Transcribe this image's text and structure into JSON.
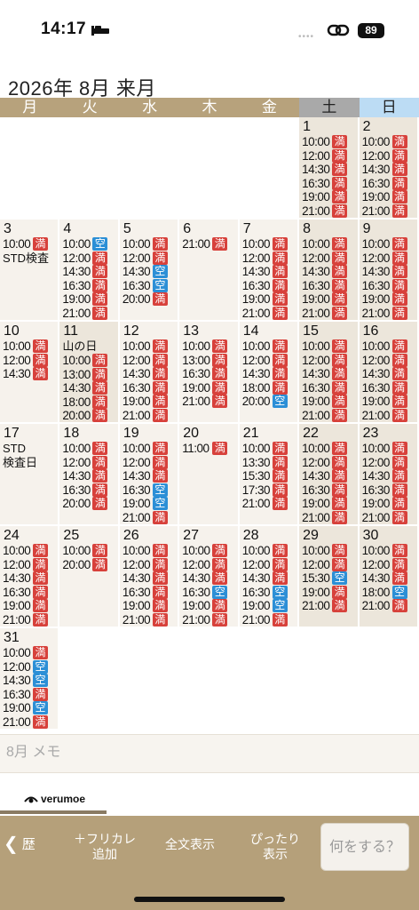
{
  "status_bar": {
    "time": "14:17",
    "battery": "89"
  },
  "calendar": {
    "title": "2026年 8月 来月",
    "weekdays": [
      "月",
      "火",
      "水",
      "木",
      "金",
      "土",
      "日"
    ],
    "labels": {
      "full": "満",
      "open": "空"
    }
  },
  "memo": {
    "placeholder": "8月 メモ"
  },
  "brand": {
    "name": "verumoe"
  },
  "toolbar": {
    "history": "歴",
    "add_free_line1": "＋フリカレ",
    "add_free_line2": "追加",
    "full_text": "全文表示",
    "fit_line1": "ぴったり",
    "fit_line2": "表示",
    "action": "何をする？"
  },
  "days": [
    {
      "d": "1",
      "wk": true,
      "s": [
        [
          "10:00",
          "f"
        ],
        [
          "12:00",
          "f"
        ],
        [
          "14:30",
          "f"
        ],
        [
          "16:30",
          "f"
        ],
        [
          "19:00",
          "f"
        ],
        [
          "21:00",
          "f"
        ]
      ]
    },
    {
      "d": "2",
      "wk": true,
      "s": [
        [
          "10:00",
          "f"
        ],
        [
          "12:00",
          "f"
        ],
        [
          "14:30",
          "f"
        ],
        [
          "16:30",
          "f"
        ],
        [
          "19:00",
          "f"
        ],
        [
          "21:00",
          "f"
        ]
      ]
    },
    {
      "d": "3",
      "s": [
        [
          "10:00",
          "f"
        ]
      ],
      "note": "STD検査"
    },
    {
      "d": "4",
      "s": [
        [
          "10:00",
          "o"
        ],
        [
          "12:00",
          "f"
        ],
        [
          "14:30",
          "f"
        ],
        [
          "16:30",
          "f"
        ],
        [
          "19:00",
          "f"
        ],
        [
          "21:00",
          "f"
        ]
      ]
    },
    {
      "d": "5",
      "s": [
        [
          "10:00",
          "f"
        ],
        [
          "12:00",
          "f"
        ],
        [
          "14:30",
          "o"
        ],
        [
          "16:30",
          "o"
        ],
        [
          "20:00",
          "f"
        ]
      ]
    },
    {
      "d": "6",
      "s": [
        [
          "21:00",
          "f"
        ]
      ]
    },
    {
      "d": "7",
      "s": [
        [
          "10:00",
          "f"
        ],
        [
          "12:00",
          "f"
        ],
        [
          "14:30",
          "f"
        ],
        [
          "16:30",
          "f"
        ],
        [
          "19:00",
          "f"
        ],
        [
          "21:00",
          "f"
        ]
      ]
    },
    {
      "d": "8",
      "wk": true,
      "s": [
        [
          "10:00",
          "f"
        ],
        [
          "12:00",
          "f"
        ],
        [
          "14:30",
          "f"
        ],
        [
          "16:30",
          "f"
        ],
        [
          "19:00",
          "f"
        ],
        [
          "21:00",
          "f"
        ]
      ]
    },
    {
      "d": "9",
      "wk": true,
      "s": [
        [
          "10:00",
          "f"
        ],
        [
          "12:00",
          "f"
        ],
        [
          "14:30",
          "f"
        ],
        [
          "16:30",
          "f"
        ],
        [
          "19:00",
          "f"
        ],
        [
          "21:00",
          "f"
        ]
      ]
    },
    {
      "d": "10",
      "s": [
        [
          "10:00",
          "f"
        ],
        [
          "12:00",
          "f"
        ],
        [
          "14:30",
          "f"
        ]
      ]
    },
    {
      "d": "11",
      "wk": true,
      "note": "山の日",
      "s": [
        [
          "10:00",
          "f"
        ],
        [
          "13:00",
          "f"
        ],
        [
          "14:30",
          "f"
        ],
        [
          "18:00",
          "f"
        ],
        [
          "20:00",
          "f"
        ]
      ]
    },
    {
      "d": "12",
      "s": [
        [
          "10:00",
          "f"
        ],
        [
          "12:00",
          "f"
        ],
        [
          "14:30",
          "f"
        ],
        [
          "16:30",
          "f"
        ],
        [
          "19:00",
          "f"
        ],
        [
          "21:00",
          "f"
        ]
      ]
    },
    {
      "d": "13",
      "s": [
        [
          "10:00",
          "f"
        ],
        [
          "13:00",
          "f"
        ],
        [
          "16:30",
          "f"
        ],
        [
          "19:00",
          "f"
        ],
        [
          "21:00",
          "f"
        ]
      ]
    },
    {
      "d": "14",
      "s": [
        [
          "10:00",
          "f"
        ],
        [
          "12:00",
          "f"
        ],
        [
          "14:30",
          "f"
        ],
        [
          "18:00",
          "f"
        ],
        [
          "20:00",
          "o"
        ]
      ]
    },
    {
      "d": "15",
      "wk": true,
      "s": [
        [
          "10:00",
          "f"
        ],
        [
          "12:00",
          "f"
        ],
        [
          "14:30",
          "f"
        ],
        [
          "16:30",
          "f"
        ],
        [
          "19:00",
          "f"
        ],
        [
          "21:00",
          "f"
        ]
      ]
    },
    {
      "d": "16",
      "wk": true,
      "s": [
        [
          "10:00",
          "f"
        ],
        [
          "12:00",
          "f"
        ],
        [
          "14:30",
          "f"
        ],
        [
          "16:30",
          "f"
        ],
        [
          "19:00",
          "f"
        ],
        [
          "21:00",
          "f"
        ]
      ]
    },
    {
      "d": "17",
      "note": "STD\n検査日",
      "s": []
    },
    {
      "d": "18",
      "s": [
        [
          "10:00",
          "f"
        ],
        [
          "12:00",
          "f"
        ],
        [
          "14:30",
          "f"
        ],
        [
          "16:30",
          "f"
        ],
        [
          "20:00",
          "f"
        ]
      ]
    },
    {
      "d": "19",
      "s": [
        [
          "10:00",
          "f"
        ],
        [
          "12:00",
          "f"
        ],
        [
          "14:30",
          "f"
        ],
        [
          "16:30",
          "o"
        ],
        [
          "19:00",
          "o"
        ],
        [
          "21:00",
          "f"
        ]
      ]
    },
    {
      "d": "20",
      "s": [
        [
          "11:00",
          "f"
        ]
      ]
    },
    {
      "d": "21",
      "s": [
        [
          "10:00",
          "f"
        ],
        [
          "13:30",
          "f"
        ],
        [
          "15:30",
          "f"
        ],
        [
          "17:30",
          "f"
        ],
        [
          "21:00",
          "f"
        ]
      ]
    },
    {
      "d": "22",
      "wk": true,
      "s": [
        [
          "10:00",
          "f"
        ],
        [
          "12:00",
          "f"
        ],
        [
          "14:30",
          "f"
        ],
        [
          "16:30",
          "f"
        ],
        [
          "19:00",
          "f"
        ],
        [
          "21:00",
          "f"
        ]
      ]
    },
    {
      "d": "23",
      "wk": true,
      "s": [
        [
          "10:00",
          "f"
        ],
        [
          "12:00",
          "f"
        ],
        [
          "14:30",
          "f"
        ],
        [
          "16:30",
          "f"
        ],
        [
          "19:00",
          "f"
        ],
        [
          "21:00",
          "f"
        ]
      ]
    },
    {
      "d": "24",
      "s": [
        [
          "10:00",
          "f"
        ],
        [
          "12:00",
          "f"
        ],
        [
          "14:30",
          "f"
        ],
        [
          "16:30",
          "f"
        ],
        [
          "19:00",
          "f"
        ],
        [
          "21:00",
          "f"
        ]
      ]
    },
    {
      "d": "25",
      "s": [
        [
          "10:00",
          "f"
        ],
        [
          "20:00",
          "f"
        ]
      ]
    },
    {
      "d": "26",
      "s": [
        [
          "10:00",
          "f"
        ],
        [
          "12:00",
          "f"
        ],
        [
          "14:30",
          "f"
        ],
        [
          "16:30",
          "f"
        ],
        [
          "19:00",
          "f"
        ],
        [
          "21:00",
          "f"
        ]
      ]
    },
    {
      "d": "27",
      "s": [
        [
          "10:00",
          "f"
        ],
        [
          "12:00",
          "f"
        ],
        [
          "14:30",
          "f"
        ],
        [
          "16:30",
          "o"
        ],
        [
          "19:00",
          "f"
        ],
        [
          "21:00",
          "f"
        ]
      ]
    },
    {
      "d": "28",
      "s": [
        [
          "10:00",
          "f"
        ],
        [
          "12:00",
          "f"
        ],
        [
          "14:30",
          "f"
        ],
        [
          "16:30",
          "o"
        ],
        [
          "19:00",
          "o"
        ],
        [
          "21:00",
          "f"
        ]
      ]
    },
    {
      "d": "29",
      "wk": true,
      "s": [
        [
          "10:00",
          "f"
        ],
        [
          "12:00",
          "f"
        ],
        [
          "15:30",
          "o"
        ],
        [
          "19:00",
          "f"
        ],
        [
          "21:00",
          "f"
        ]
      ]
    },
    {
      "d": "30",
      "wk": true,
      "s": [
        [
          "10:00",
          "f"
        ],
        [
          "12:00",
          "f"
        ],
        [
          "14:30",
          "f"
        ],
        [
          "18:00",
          "o"
        ],
        [
          "21:00",
          "f"
        ]
      ]
    },
    {
      "d": "31",
      "s": [
        [
          "10:00",
          "f"
        ],
        [
          "12:00",
          "o"
        ],
        [
          "14:30",
          "o"
        ],
        [
          "16:30",
          "f"
        ],
        [
          "19:00",
          "o"
        ],
        [
          "21:00",
          "f"
        ]
      ]
    }
  ]
}
